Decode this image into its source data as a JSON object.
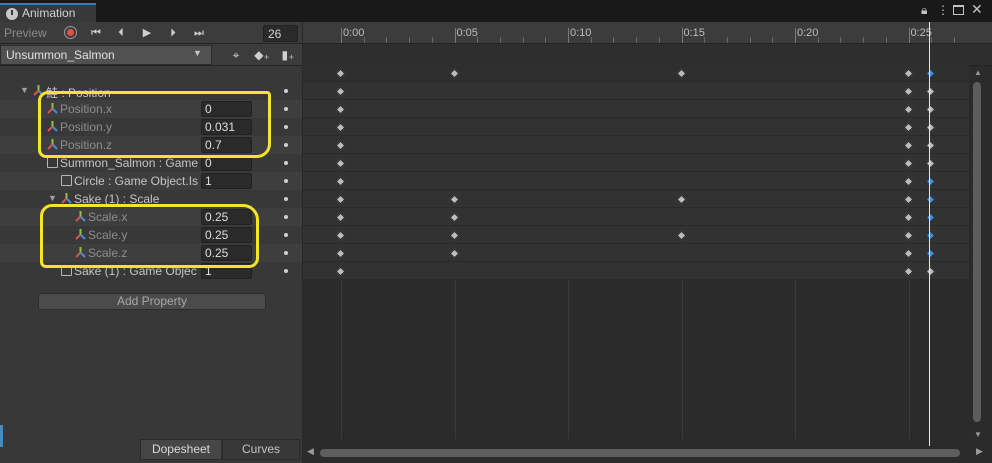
{
  "window": {
    "tab_title": "Animation",
    "icons": [
      "lock-icon",
      "kebab-menu-icon",
      "maximize-icon",
      "close-icon"
    ]
  },
  "toolbar": {
    "preview_label": "Preview",
    "frame": "26",
    "clip_name": "Unsummon_Salmon",
    "record_color": "#e0533f"
  },
  "properties": [
    {
      "label": "鮭 : Position",
      "value": ""
    },
    {
      "label": "Position.x",
      "value": "0"
    },
    {
      "label": "Position.y",
      "value": "0.031"
    },
    {
      "label": "Position.z",
      "value": "0.7"
    },
    {
      "label": "Summon_Salmon : Game",
      "value": "0"
    },
    {
      "label": "Circle : Game Object.Is",
      "value": "1"
    },
    {
      "label": "Sake (1) : Scale",
      "value": ""
    },
    {
      "label": "Scale.x",
      "value": "0.25"
    },
    {
      "label": "Scale.y",
      "value": "0.25"
    },
    {
      "label": "Scale.z",
      "value": "0.25"
    },
    {
      "label": "Sake (1) : Game Objec",
      "value": "1"
    }
  ],
  "add_property_label": "Add Property",
  "bottom_tabs": {
    "dopesheet": "Dopesheet",
    "curves": "Curves"
  },
  "timeline": {
    "ticks": [
      "0:00",
      "0:05",
      "0:10",
      "0:15",
      "0:20",
      "0:25"
    ],
    "current_frame": 26,
    "highlight_color": "#f6e32a",
    "key_color": "#bdbdbd",
    "selected_key_color": "#3e8ee0"
  }
}
